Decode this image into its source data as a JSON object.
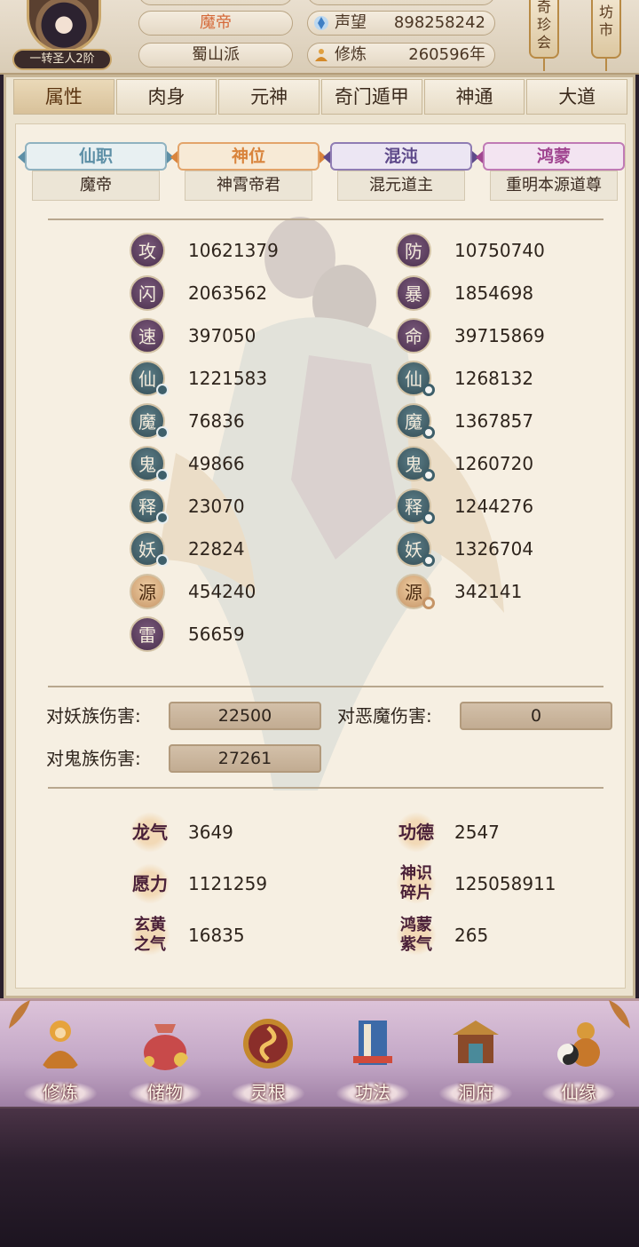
{
  "header": {
    "rank_badge": "一转圣人2阶",
    "title": "魔帝",
    "sect": "蜀山派",
    "fame_label": "声望",
    "fame_value": "898258242",
    "cultivation_label": "修炼",
    "cultivation_value": "260596年",
    "side_tag_left": "奇珍会",
    "side_tag_right": "坊市"
  },
  "tabs": [
    "属性",
    "肉身",
    "元神",
    "奇门遁甲",
    "神通",
    "大道"
  ],
  "ranks": [
    {
      "label": "仙职",
      "value": "魔帝"
    },
    {
      "label": "神位",
      "value": "神霄帝君"
    },
    {
      "label": "混沌",
      "value": "混元道主"
    },
    {
      "label": "鸿蒙",
      "value": "重明本源道尊"
    }
  ],
  "attributes_left": [
    {
      "glyph": "攻",
      "value": "10621379"
    },
    {
      "glyph": "闪",
      "value": "2063562"
    },
    {
      "glyph": "速",
      "value": "397050"
    },
    {
      "glyph": "仙",
      "value": "1221583"
    },
    {
      "glyph": "魔",
      "value": "76836"
    },
    {
      "glyph": "鬼",
      "value": "49866"
    },
    {
      "glyph": "释",
      "value": "23070"
    },
    {
      "glyph": "妖",
      "value": "22824"
    },
    {
      "glyph": "源",
      "value": "454240"
    },
    {
      "glyph": "雷",
      "value": "56659"
    }
  ],
  "attributes_right": [
    {
      "glyph": "防",
      "value": "10750740"
    },
    {
      "glyph": "暴",
      "value": "1854698"
    },
    {
      "glyph": "命",
      "value": "39715869"
    },
    {
      "glyph": "仙",
      "value": "1268132"
    },
    {
      "glyph": "魔",
      "value": "1367857"
    },
    {
      "glyph": "鬼",
      "value": "1260720"
    },
    {
      "glyph": "释",
      "value": "1244276"
    },
    {
      "glyph": "妖",
      "value": "1326704"
    },
    {
      "glyph": "源",
      "value": "342141"
    }
  ],
  "damage": {
    "vs_demon_race_label": "对妖族伤害:",
    "vs_demon_race_value": "22500",
    "vs_evil_demon_label": "对恶魔伤害:",
    "vs_evil_demon_value": "0",
    "vs_ghost_race_label": "对鬼族伤害:",
    "vs_ghost_race_value": "27261"
  },
  "resources": [
    {
      "icon": "龙气",
      "value": "3649"
    },
    {
      "icon": "功德",
      "value": "2547"
    },
    {
      "icon": "愿力",
      "value": "1121259"
    },
    {
      "icon_line1": "神识",
      "icon_line2": "碎片",
      "value": "125058911"
    },
    {
      "icon_line1": "玄黄",
      "icon_line2": "之气",
      "value": "16835"
    },
    {
      "icon_line1": "鸿蒙",
      "icon_line2": "紫气",
      "value": "265"
    }
  ],
  "bottom_nav": [
    "修炼",
    "储物",
    "灵根",
    "功法",
    "洞府",
    "仙缘"
  ],
  "colors": {
    "accent_orange": "#d56a3a",
    "badge_purple": "#5e3d60",
    "badge_teal": "#3e5f6a",
    "badge_gold": "#d8a978"
  }
}
